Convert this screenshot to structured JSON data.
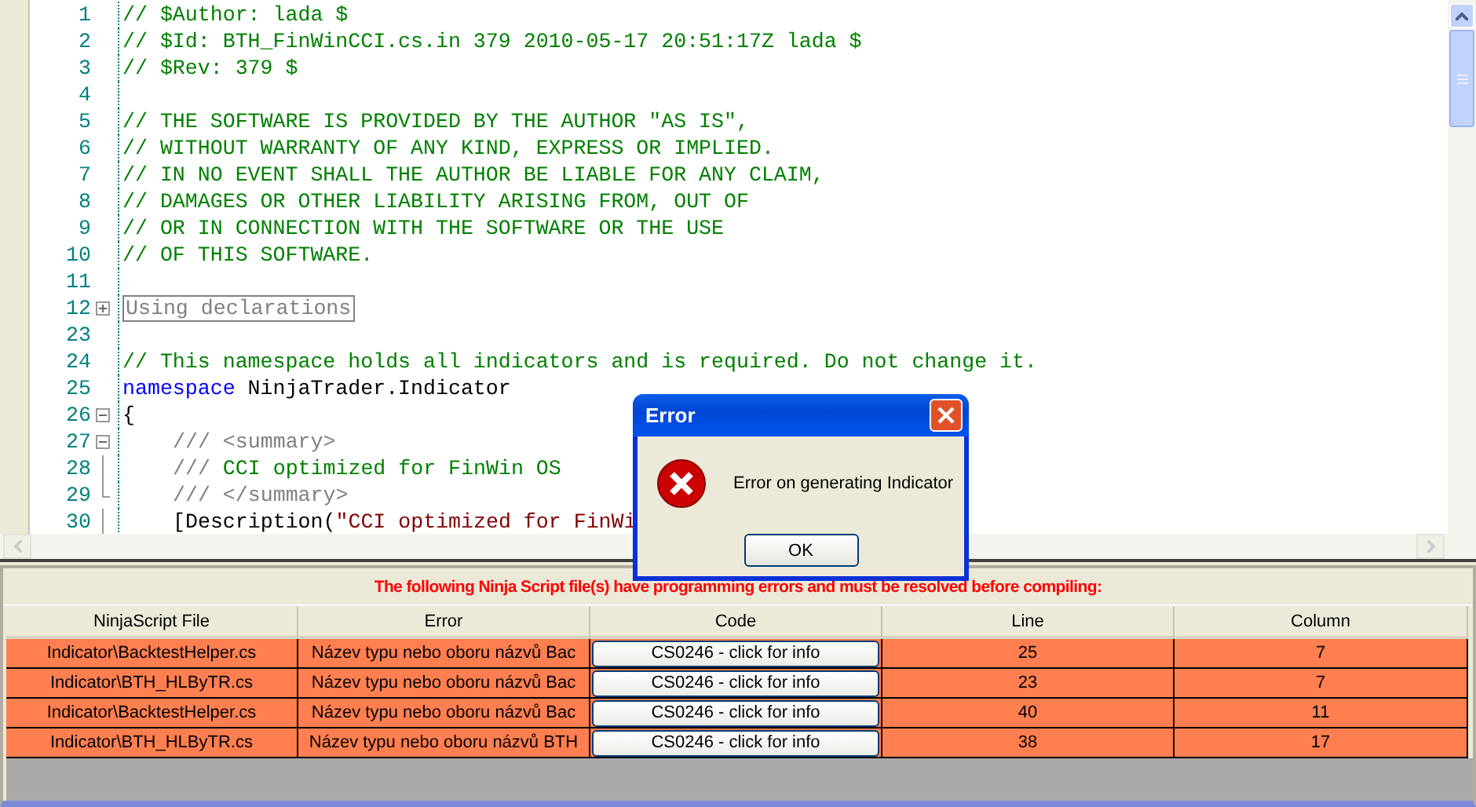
{
  "editor": {
    "lines": [
      {
        "number": "1",
        "segments": [
          {
            "kind": "comment",
            "text": "// $Author: lada $"
          }
        ]
      },
      {
        "number": "2",
        "segments": [
          {
            "kind": "comment",
            "text": "// $Id: BTH_FinWinCCI.cs.in 379 2010-05-17 20:51:17Z lada $"
          }
        ]
      },
      {
        "number": "3",
        "segments": [
          {
            "kind": "comment",
            "text": "// $Rev: 379 $"
          }
        ]
      },
      {
        "number": "4"
      },
      {
        "number": "5",
        "segments": [
          {
            "kind": "comment",
            "text": "// THE SOFTWARE IS PROVIDED BY THE AUTHOR \"AS IS\","
          }
        ]
      },
      {
        "number": "6",
        "segments": [
          {
            "kind": "comment",
            "text": "// WITHOUT WARRANTY OF ANY KIND, EXPRESS OR IMPLIED."
          }
        ]
      },
      {
        "number": "7",
        "segments": [
          {
            "kind": "comment",
            "text": "// IN NO EVENT SHALL THE AUTHOR BE LIABLE FOR ANY CLAIM,"
          }
        ]
      },
      {
        "number": "8",
        "segments": [
          {
            "kind": "comment",
            "text": "// DAMAGES OR OTHER LIABILITY ARISING FROM, OUT OF"
          }
        ]
      },
      {
        "number": "9",
        "segments": [
          {
            "kind": "comment",
            "text": "// OR IN CONNECTION WITH THE SOFTWARE OR THE USE"
          }
        ]
      },
      {
        "number": "10",
        "segments": [
          {
            "kind": "comment",
            "text": "// OF THIS SOFTWARE."
          }
        ]
      },
      {
        "number": "11"
      },
      {
        "number": "12",
        "kind": "expand",
        "segments": [
          {
            "kind": "collapsed",
            "text": "Using declarations"
          }
        ]
      },
      {
        "number": "23"
      },
      {
        "number": "24",
        "segments": [
          {
            "kind": "comment",
            "text": "// This namespace holds all indicators and is required. Do not change it."
          }
        ]
      },
      {
        "number": "25",
        "segments": [
          {
            "kind": "keyword",
            "text": "namespace"
          },
          {
            "kind": "plain",
            "text": " NinjaTrader.Indicator"
          }
        ]
      },
      {
        "number": "26",
        "kind": "collapse",
        "segments": [
          {
            "kind": "plain",
            "text": "{"
          }
        ]
      },
      {
        "number": "27",
        "kind": "collapse",
        "indented": true,
        "segments": [
          {
            "kind": "doc",
            "text": "/// <summary>"
          }
        ]
      },
      {
        "number": "28",
        "kind": "guide",
        "indented": true,
        "segments": [
          {
            "kind": "doc",
            "text": "///"
          },
          {
            "kind": "comment",
            "text": " CCI optimized for FinWin OS"
          }
        ]
      },
      {
        "number": "29",
        "kind": "guideend",
        "indented": true,
        "segments": [
          {
            "kind": "doc",
            "text": "/// </summary>"
          }
        ]
      },
      {
        "number": "30",
        "kind": "guide",
        "indented": true,
        "segments": [
          {
            "kind": "plain",
            "text": "[Description("
          },
          {
            "kind": "string",
            "text": "\"CCI optimized for FinWi"
          }
        ]
      }
    ]
  },
  "dialog": {
    "title": "Error",
    "message": "Error on generating Indicator",
    "button": "OK"
  },
  "errors": {
    "banner": "The following Ninja Script file(s) have programming errors and must be resolved before compiling:",
    "columns": [
      "NinjaScript File",
      "Error",
      "Code",
      "Line",
      "Column"
    ],
    "rows": [
      {
        "file": "Indicator\\BacktestHelper.cs",
        "error": "Název typu nebo oboru názvů Bac",
        "code": "CS0246 - click for info",
        "line": "25",
        "column": "7"
      },
      {
        "file": "Indicator\\BTH_HLByTR.cs",
        "error": "Název typu nebo oboru názvů Bac",
        "code": "CS0246 - click for info",
        "line": "23",
        "column": "7"
      },
      {
        "file": "Indicator\\BacktestHelper.cs",
        "error": "Název typu nebo oboru názvů Bac",
        "code": "CS0246 - click for info",
        "line": "40",
        "column": "11"
      },
      {
        "file": "Indicator\\BTH_HLByTR.cs",
        "error": "Název typu nebo oboru názvů BTH",
        "code": "CS0246 - click for info",
        "line": "38",
        "column": "17"
      }
    ]
  }
}
